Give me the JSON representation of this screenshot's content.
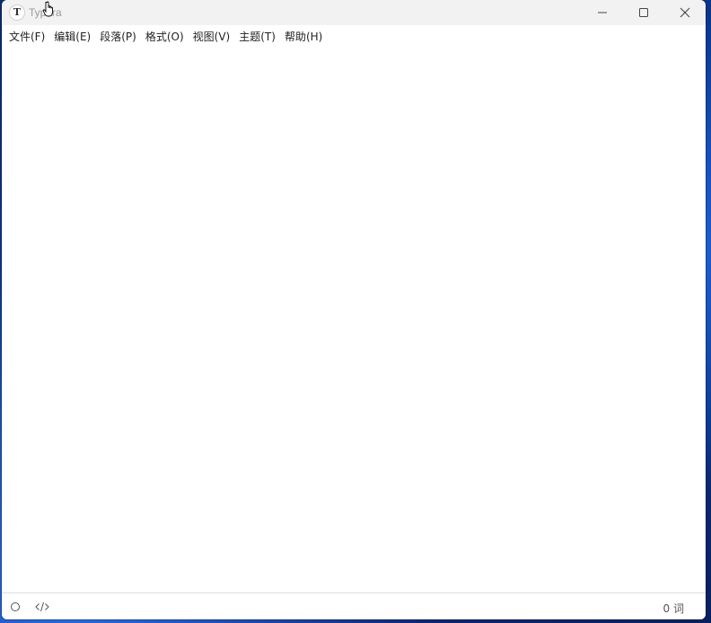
{
  "window": {
    "title": "Typora",
    "app_icon_letter": "T"
  },
  "menu": {
    "items": [
      {
        "label": "文件(F)"
      },
      {
        "label": "编辑(E)"
      },
      {
        "label": "段落(P)"
      },
      {
        "label": "格式(O)"
      },
      {
        "label": "视图(V)"
      },
      {
        "label": "主题(T)"
      },
      {
        "label": "帮助(H)"
      }
    ]
  },
  "status_bar": {
    "word_count": "0 词"
  },
  "icons": {
    "minimize": "minimize-icon",
    "maximize": "maximize-icon",
    "close": "close-icon",
    "outline": "circle-outline-icon",
    "source": "code-brackets-icon"
  }
}
